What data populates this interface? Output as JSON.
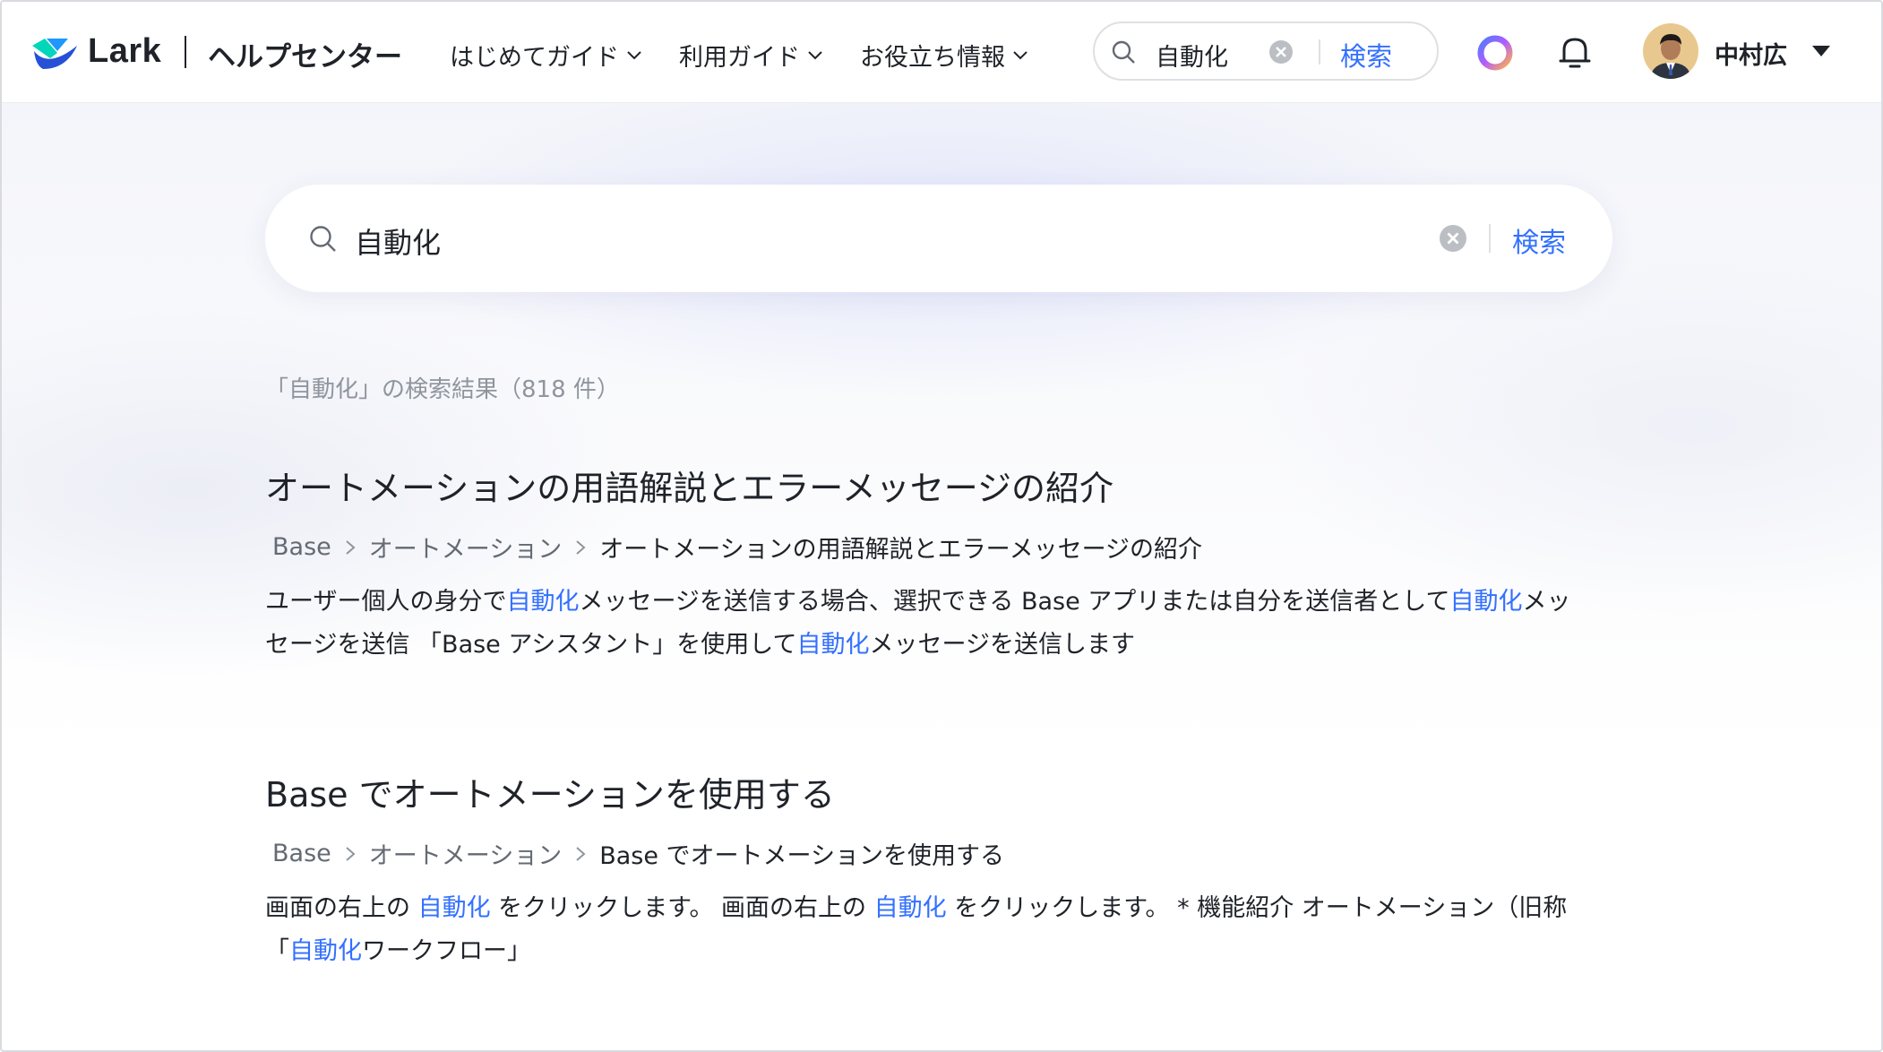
{
  "header": {
    "logo_text": "Lark",
    "help_center": "ヘルプセンター",
    "nav": [
      {
        "label": "はじめてガイド"
      },
      {
        "label": "利用ガイド"
      },
      {
        "label": "お役立ち情報"
      }
    ],
    "search": {
      "value": "自動化",
      "button": "検索"
    },
    "user_name": "中村広"
  },
  "main_search": {
    "value": "自動化",
    "button": "検索"
  },
  "result_count": "「自動化」の検索結果（818 件）",
  "results": [
    {
      "title": "オートメーションの用語解説とエラーメッセージの紹介",
      "breadcrumb": [
        "Base",
        "オートメーション",
        "オートメーションの用語解説とエラーメッセージの紹介"
      ],
      "snippet_lines": [
        [
          {
            "t": "ユーザー個人の身分で"
          },
          {
            "t": "自動化",
            "hl": true
          },
          {
            "t": "メッセージを送信する場合、選択できる Base アプリまたは自分を送信者として"
          },
          {
            "t": "自動化",
            "hl": true
          },
          {
            "t": "メッ"
          }
        ],
        [
          {
            "t": "セージを送信 「Base アシスタント」を使用して"
          },
          {
            "t": "自動化",
            "hl": true
          },
          {
            "t": "メッセージを送信します"
          }
        ]
      ]
    },
    {
      "title": "Base でオートメーションを使用する",
      "breadcrumb": [
        "Base",
        "オートメーション",
        "Base でオートメーションを使用する"
      ],
      "snippet_lines": [
        [
          {
            "t": "画面の右上の "
          },
          {
            "t": "自動化",
            "hl": true
          },
          {
            "t": " をクリックします。 画面の右上の "
          },
          {
            "t": "自動化",
            "hl": true
          },
          {
            "t": " をクリックします。 * 機能紹介 オートメーション（旧称"
          }
        ],
        [
          {
            "t": "「"
          },
          {
            "t": "自動化",
            "hl": true
          },
          {
            "t": "ワークフロー」"
          }
        ]
      ]
    }
  ],
  "colors": {
    "accent": "#3370ff",
    "text": "#1f2329",
    "muted": "#8f959e"
  }
}
